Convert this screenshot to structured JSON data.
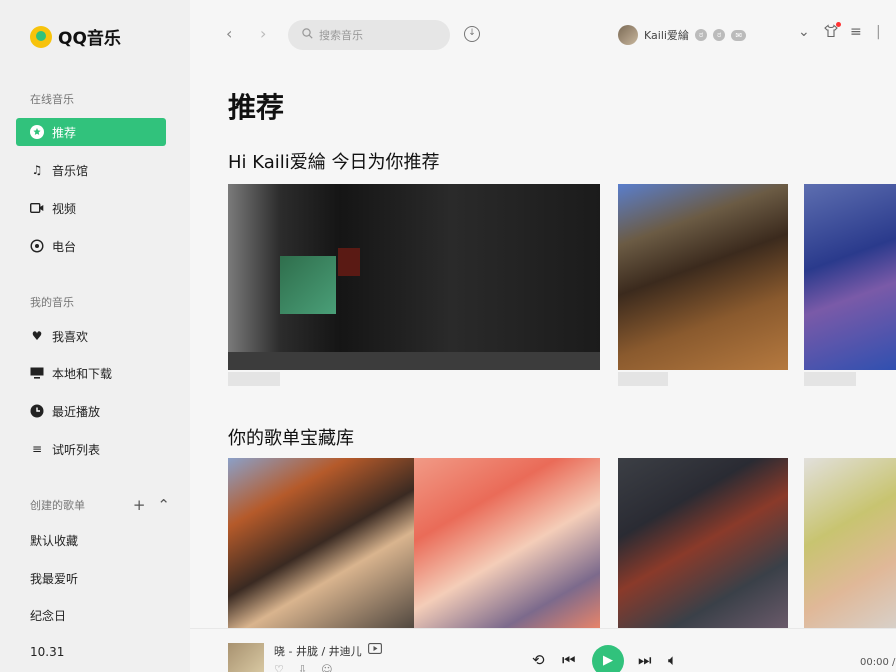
{
  "app": {
    "name": "QQ音乐"
  },
  "sidebar": {
    "online_title": "在线音乐",
    "online_items": [
      {
        "label": "推荐",
        "icon": "star-icon",
        "active": true
      },
      {
        "label": "音乐馆",
        "icon": "music-note-icon"
      },
      {
        "label": "视频",
        "icon": "video-icon"
      },
      {
        "label": "电台",
        "icon": "radio-icon"
      }
    ],
    "my_title": "我的音乐",
    "my_items": [
      {
        "label": "我喜欢",
        "icon": "heart-icon"
      },
      {
        "label": "本地和下载",
        "icon": "monitor-icon"
      },
      {
        "label": "最近播放",
        "icon": "clock-icon"
      },
      {
        "label": "试听列表",
        "icon": "list-icon"
      }
    ],
    "created_title": "创建的歌单",
    "playlists": [
      "默认收藏",
      "我最爱听",
      "纪念日",
      "10.31"
    ]
  },
  "topbar": {
    "search_placeholder": "搜索音乐",
    "username": "Kaili爱綸",
    "badges": [
      "ಠ",
      "ಠ",
      "✉"
    ]
  },
  "main": {
    "page_title": "推荐",
    "section1_title": "Hi Kaili爱綸 今日为你推荐",
    "section2_title": "你的歌单宝藏库"
  },
  "player": {
    "song": "晓 - 井胧 / 井迪儿",
    "time": "00:00 /"
  },
  "colors": {
    "accent": "#31c27c"
  }
}
